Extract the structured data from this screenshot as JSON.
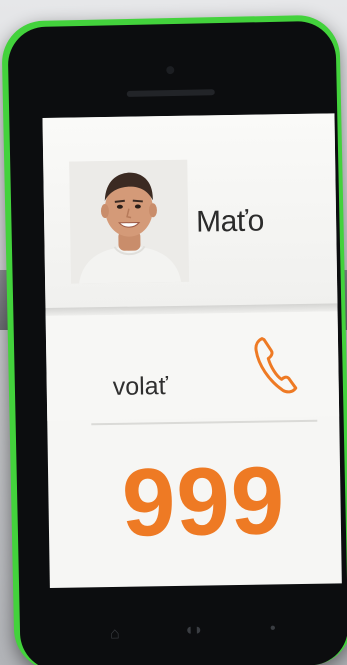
{
  "contact": {
    "name": "Maťo"
  },
  "actions": {
    "call_label": "volať"
  },
  "dial": {
    "number": "999"
  },
  "colors": {
    "phone_body": "#43d23c",
    "accent": "#ee7a24",
    "screen_bg": "#f6f6f4"
  },
  "icons": {
    "call": "phone-handset-icon",
    "avatar": "contact-photo"
  }
}
